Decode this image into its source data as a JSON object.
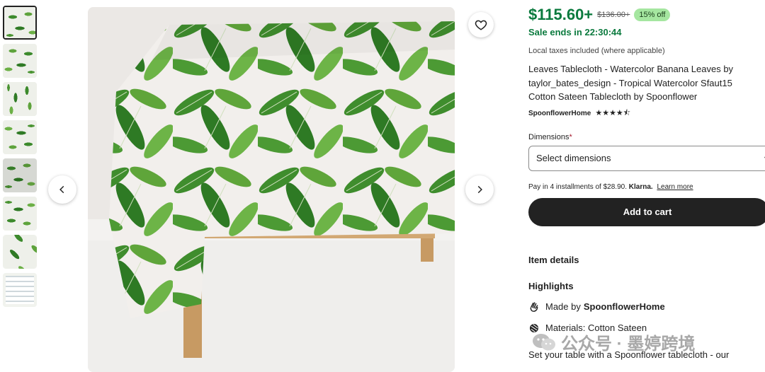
{
  "gallery": {
    "thumbnails": [
      {
        "label": "thumb-1"
      },
      {
        "label": "thumb-2"
      },
      {
        "label": "thumb-3"
      },
      {
        "label": "thumb-4"
      },
      {
        "label": "thumb-5"
      },
      {
        "label": "thumb-6"
      },
      {
        "label": "thumb-7"
      },
      {
        "label": "thumb-8"
      }
    ],
    "favorite_icon": "heart-icon",
    "prev_icon": "chevron-left-icon",
    "next_icon": "chevron-right-icon"
  },
  "product": {
    "price": "$115.60+",
    "original_price": "$136.00+",
    "discount_badge": "15% off",
    "sale_text": "Sale ends in 22:30:44",
    "tax_note": "Local taxes included (where applicable)",
    "title": "Leaves Tablecloth - Watercolor Banana Leaves by taylor_bates_design - Tropical Watercolor Sfaut15 Cotton Sateen Tablecloth by Spoonflower",
    "shop_name": "SpoonflowerHome",
    "rating_stars": "★★★★⯪",
    "dimensions_label": "Dimensions",
    "dimensions_required": "*",
    "dimensions_placeholder": "Select dimensions",
    "klarna_text": "Pay in 4 installments of $28.90.",
    "klarna_brand": "Klarna.",
    "klarna_link": "Learn more",
    "add_to_cart": "Add to cart",
    "item_details": "Item details",
    "highlights": "Highlights",
    "made_by_prefix": "Made by",
    "made_by_shop": "SpoonflowerHome",
    "materials": "Materials: Cotton Sateen",
    "description": "Set your table with a Spoonflower tablecloth - our"
  },
  "watermark": {
    "text": "公众号 · 墨婷跨境"
  },
  "colors": {
    "price_green": "#0b7a3e",
    "badge_bg": "#a5e6a0",
    "button_bg": "#222222"
  }
}
